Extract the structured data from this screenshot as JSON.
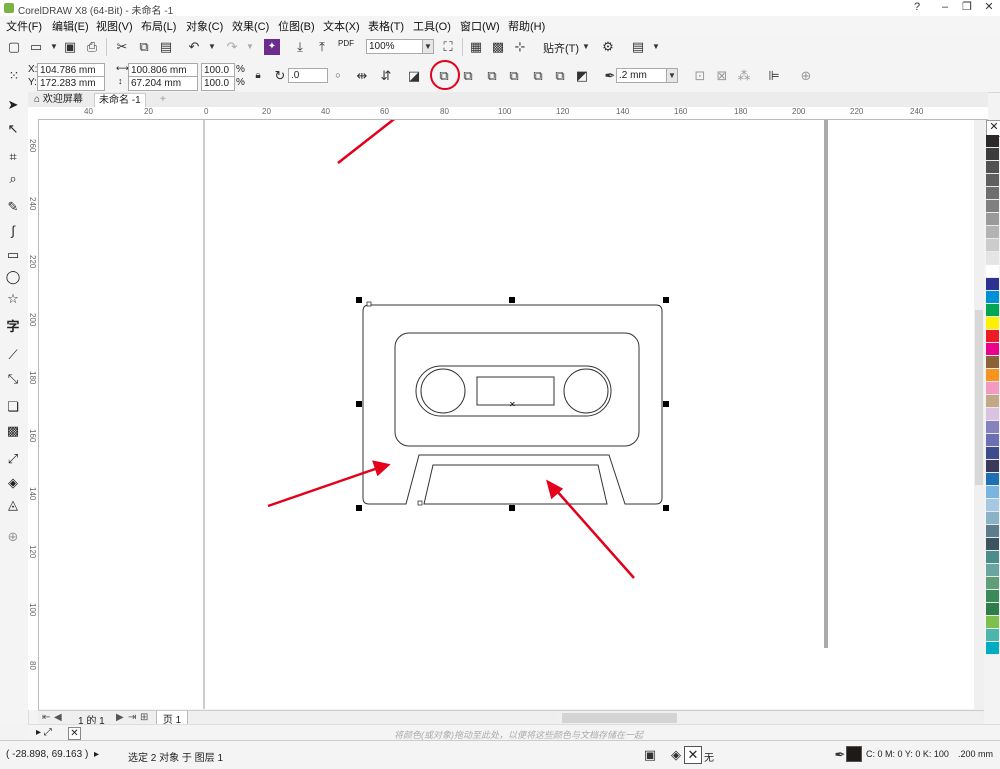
{
  "window": {
    "title": "CorelDRAW X8 (64-Bit) - 未命名 -1",
    "controls": [
      "?",
      "–",
      "❐",
      "✕"
    ]
  },
  "menu": [
    "文件(F)",
    "编辑(E)",
    "视图(V)",
    "布局(L)",
    "对象(C)",
    "效果(C)",
    "位图(B)",
    "文本(X)",
    "表格(T)",
    "工具(O)",
    "窗口(W)",
    "帮助(H)"
  ],
  "toolbar": {
    "zoom": "100%",
    "snap": "贴齐(T)",
    "pdf": "PDF"
  },
  "property_bar": {
    "x_label": "X:",
    "x": "104.786 mm",
    "y_label": "Y:",
    "y": "172.283 mm",
    "w": "100.806 mm",
    "h": "67.204 mm",
    "scale_w": "100.0",
    "scale_h": "100.0",
    "pct": "%",
    "rotation": ".0",
    "outline_width": ".2 mm"
  },
  "doc_tabs": {
    "welcome": "欢迎屏幕",
    "doc": "未命名 -1",
    "add": "+"
  },
  "ruler": {
    "h_labels": [
      "40",
      "20",
      "0",
      "20",
      "40",
      "60",
      "80",
      "100",
      "120",
      "140",
      "160",
      "180",
      "200",
      "220",
      "240"
    ],
    "v_labels": [
      "260",
      "240",
      "220",
      "200",
      "180",
      "160",
      "140",
      "120",
      "100",
      "80"
    ]
  },
  "page_nav": {
    "page_count": "1 的 1",
    "page_tab": "页 1"
  },
  "color_hint": "将颜色(或对象)拖动至此处，以便将这些颜色与文档存储在一起",
  "status": {
    "coords": "( -28.898, 69.163 )",
    "selection": "选定 2 对象 于 图层 1",
    "fill_none": "无",
    "outline_color": "C: 0 M: 0 Y: 0 K: 100",
    "outline_width": ".200 mm"
  },
  "palette": [
    "#2b2a29",
    "#3d3d3d",
    "#525252",
    "#5f5f5f",
    "#6e6e6e",
    "#808080",
    "#9a9a9a",
    "#b3b3b3",
    "#cccccc",
    "#e5e5e5",
    "#ffffff",
    "#2e3192",
    "#0090d5",
    "#00a651",
    "#fff200",
    "#ed1c24",
    "#ec008c",
    "#8c6239",
    "#f7931e",
    "#f49ac1",
    "#c2a886",
    "#d9c3e0",
    "#8781bd",
    "#6b6fb4",
    "#3f4c8c",
    "#3c3a5a",
    "#1f6fb5",
    "#7ab4e0",
    "#a6c8e4",
    "#8bb3c8",
    "#5d7c8c",
    "#3c5460",
    "#4b8c8c",
    "#6aa5a0",
    "#5f9f77",
    "#3b8b5a",
    "#2e7d4a",
    "#7fbf4d",
    "#4db6ac",
    "#00acc1"
  ],
  "accent": "#e4001b"
}
